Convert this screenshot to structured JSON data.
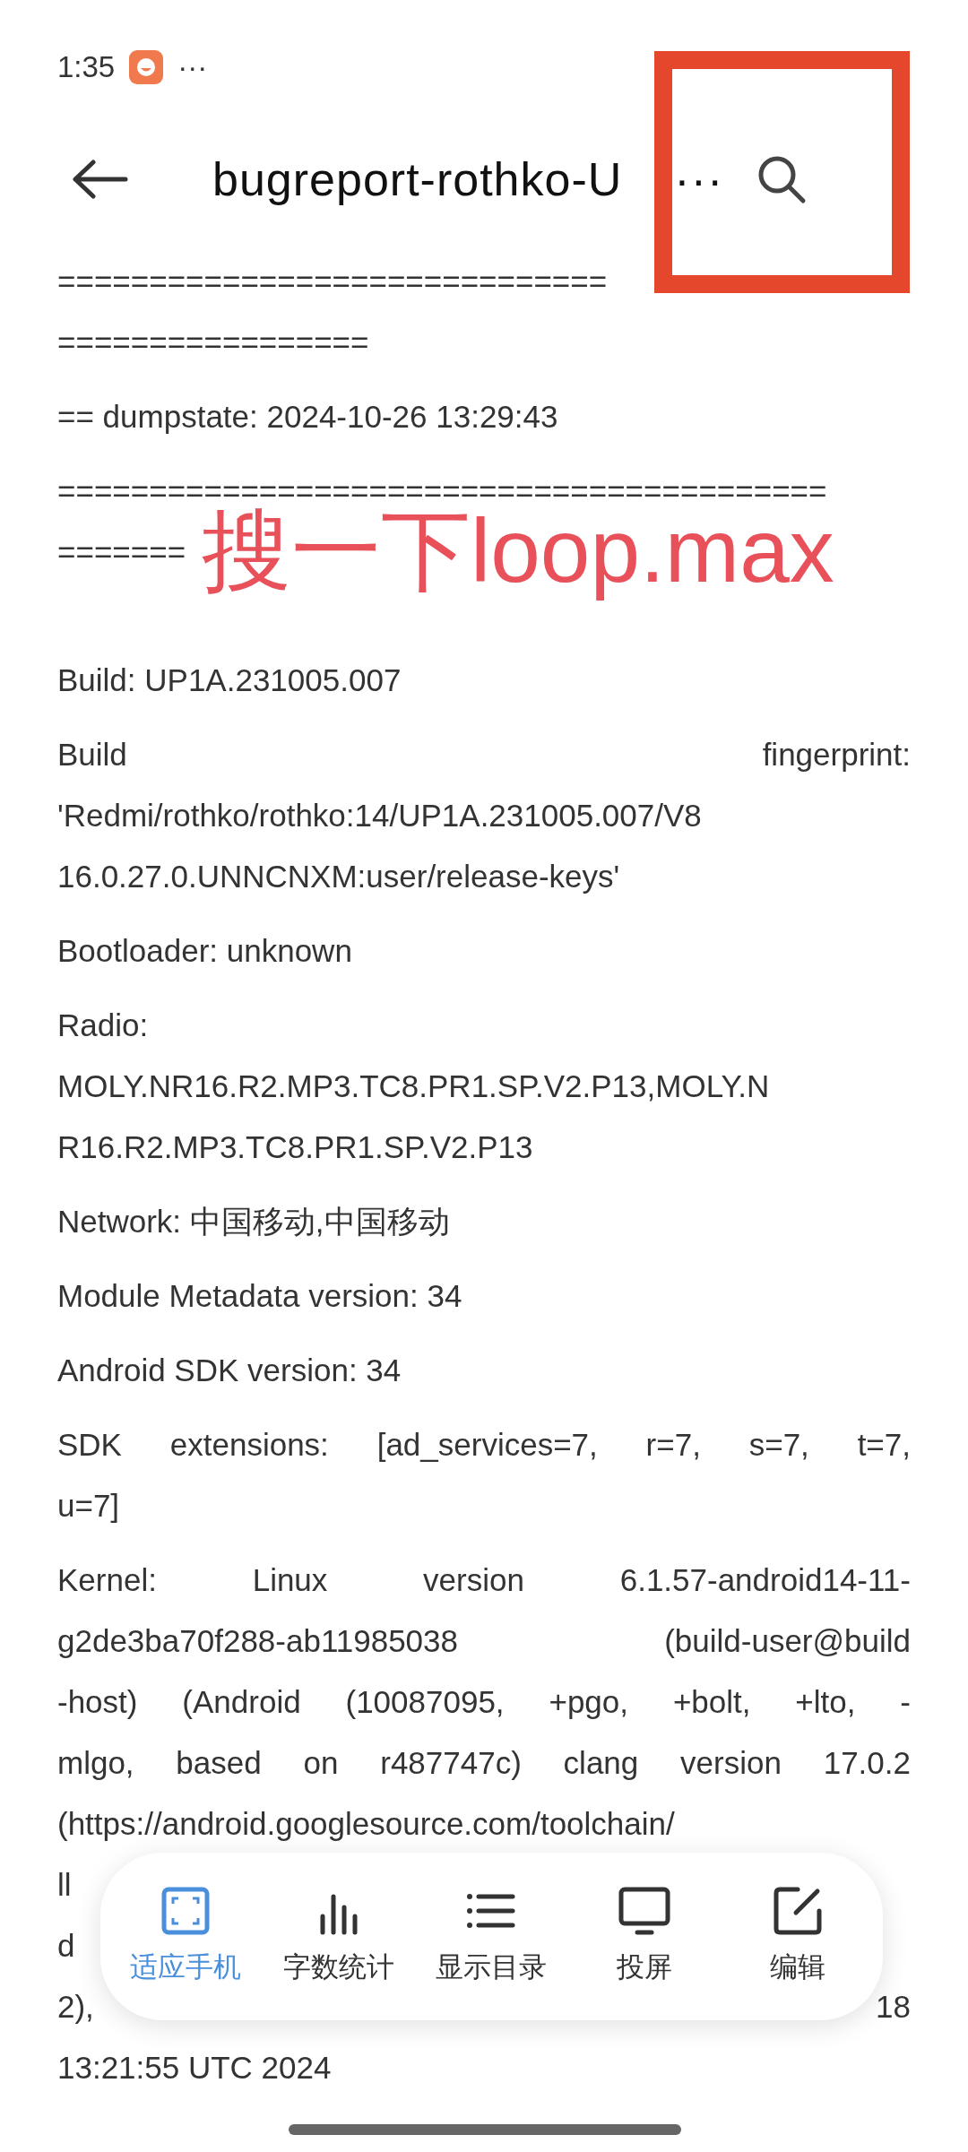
{
  "status_bar": {
    "time": "1:35",
    "more": "···"
  },
  "header": {
    "title": "bugreport-rothko-U",
    "title_more": "···"
  },
  "document": {
    "paragraphs": [
      {
        "lines": [
          "==============================",
          "================="
        ]
      },
      {
        "lines": [
          "== dumpstate: 2024-10-26 13:29:43"
        ]
      },
      {
        "lines": [
          "==========================================",
          "======="
        ]
      },
      {
        "lines": [
          "Build: UP1A.231005.007"
        ]
      },
      {
        "lines": [
          "Build fingerprint:",
          "'Redmi/rothko/rothko:14/UP1A.231005.007/V8",
          "16.0.27.0.UNNCNXM:user/release-keys'"
        ]
      },
      {
        "lines": [
          "Bootloader: unknown"
        ]
      },
      {
        "lines": [
          "Radio:",
          "MOLY.NR16.R2.MP3.TC8.PR1.SP.V2.P13,MOLY.N",
          "R16.R2.MP3.TC8.PR1.SP.V2.P13"
        ]
      },
      {
        "lines": [
          "Network: 中国移动,中国移动"
        ]
      },
      {
        "lines": [
          "Module Metadata version: 34"
        ]
      },
      {
        "lines": [
          "Android SDK version: 34"
        ]
      },
      {
        "lines": [
          "SDK extensions: [ad_services=7, r=7, s=7, t=7,",
          "u=7]"
        ]
      },
      {
        "lines": [
          "Kernel: Linux version 6.1.57-android14-11-",
          "g2de3ba70f288-ab11985038 (build-user@build",
          "-host) (Android (10087095, +pgo, +bolt, +lto, -",
          "mlgo, based on r487747c) clang version 17.0.2",
          "(https://android.googlesource.com/toolchain/",
          "ll",
          "d",
          "2), 18",
          "13:21:55 UTC 2024"
        ]
      }
    ]
  },
  "annotation": {
    "note": "搜一下loop.max",
    "highlight_box": true
  },
  "toolbar": {
    "items": [
      {
        "kind": "fit",
        "label": "适应手机",
        "selected": true
      },
      {
        "kind": "stats",
        "label": "字数统计",
        "selected": false
      },
      {
        "kind": "toc",
        "label": "显示目录",
        "selected": false
      },
      {
        "kind": "cast",
        "label": "投屏",
        "selected": false
      },
      {
        "kind": "edit",
        "label": "编辑",
        "selected": false
      }
    ]
  }
}
